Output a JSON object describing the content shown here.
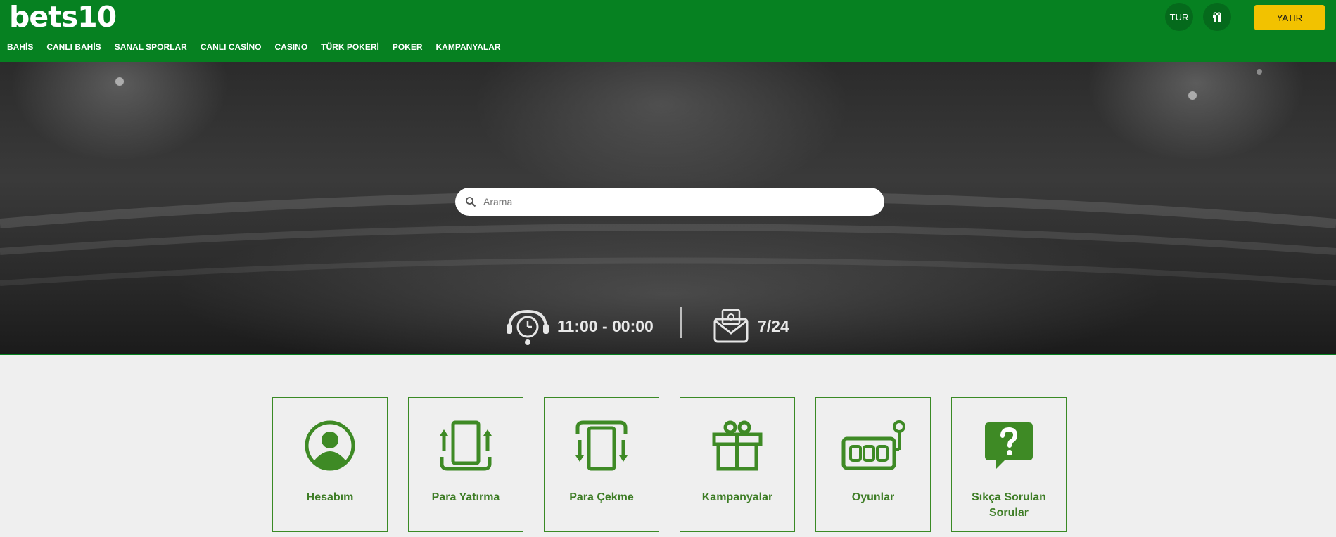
{
  "header": {
    "logo": "bets10",
    "nav": [
      "BAHİS",
      "CANLI BAHİS",
      "SANAL SPORLAR",
      "CANLI CASİNO",
      "CASINO",
      "TÜRK POKERİ",
      "POKER",
      "KAMPANYALAR"
    ],
    "language": "TUR",
    "deposit_label": "YATIR"
  },
  "hero": {
    "search_placeholder": "Arama",
    "support_hours": "11:00 - 00:00",
    "support_mail": "7/24"
  },
  "cards": [
    {
      "label": "Hesabım",
      "icon": "user-icon"
    },
    {
      "label": "Para Yatırma",
      "icon": "deposit-icon"
    },
    {
      "label": "Para Çekme",
      "icon": "withdraw-icon"
    },
    {
      "label": "Kampanyalar",
      "icon": "gift-icon"
    },
    {
      "label": "Oyunlar",
      "icon": "slot-machine-icon"
    },
    {
      "label": "Sıkça Sorulan Sorular",
      "icon": "faq-icon"
    }
  ],
  "colors": {
    "header_bg": "#068121",
    "deposit_bg": "#f2c200",
    "card_accent": "#3e8a25",
    "page_bg": "#efefef"
  }
}
